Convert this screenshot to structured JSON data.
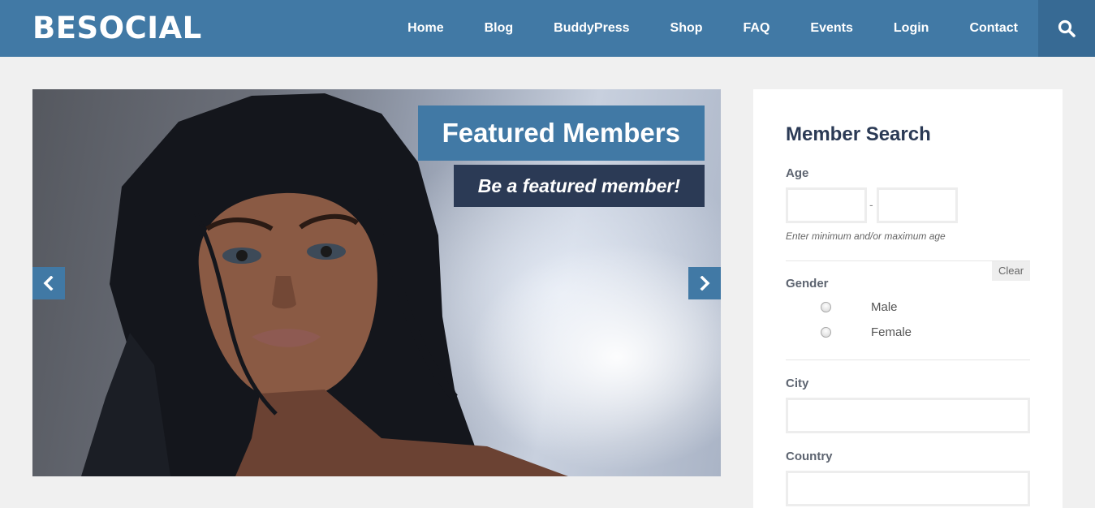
{
  "header": {
    "logo": "BESOCIAL",
    "nav": [
      "Home",
      "Blog",
      "BuddyPress",
      "Shop",
      "FAQ",
      "Events",
      "Login",
      "Contact"
    ],
    "search_icon": "search-icon"
  },
  "slider": {
    "title": "Featured Members",
    "subtitle": "Be a featured member!",
    "prev_icon": "chevron-left-icon",
    "next_icon": "chevron-right-icon"
  },
  "member_search": {
    "title": "Member Search",
    "age_label": "Age",
    "age_min_value": "",
    "age_max_value": "",
    "age_separator": "-",
    "age_hint": "Enter minimum and/or maximum age",
    "clear_label": "Clear",
    "gender_label": "Gender",
    "gender_options": [
      "Male",
      "Female"
    ],
    "city_label": "City",
    "city_value": "",
    "country_label": "Country",
    "country_value": ""
  },
  "colors": {
    "brand": "#4179a5",
    "brand_dark": "#376a94",
    "navy": "#2b3a55",
    "page_bg": "#f0f0f0"
  }
}
